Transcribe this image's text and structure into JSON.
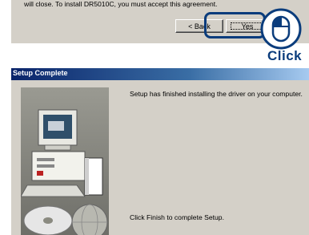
{
  "license_dialog": {
    "text": "will close.  To install DR5010C, you must accept this agreement.",
    "back_button": "< Back",
    "yes_button": "Yes",
    "callout_label": "Click"
  },
  "setup_complete_dialog": {
    "title": "Setup Complete",
    "message": "Setup has finished installing the driver on your computer.",
    "instruction": "Click Finish to complete Setup."
  },
  "colors": {
    "dialog_face": "#d4d0c8",
    "title_bar_start": "#0a246a",
    "title_bar_end": "#a6caf0",
    "callout_outline": "#0a3c7c"
  },
  "icons": [
    "mouse-icon",
    "computer-illustration-icon",
    "cd-disc-icon"
  ]
}
